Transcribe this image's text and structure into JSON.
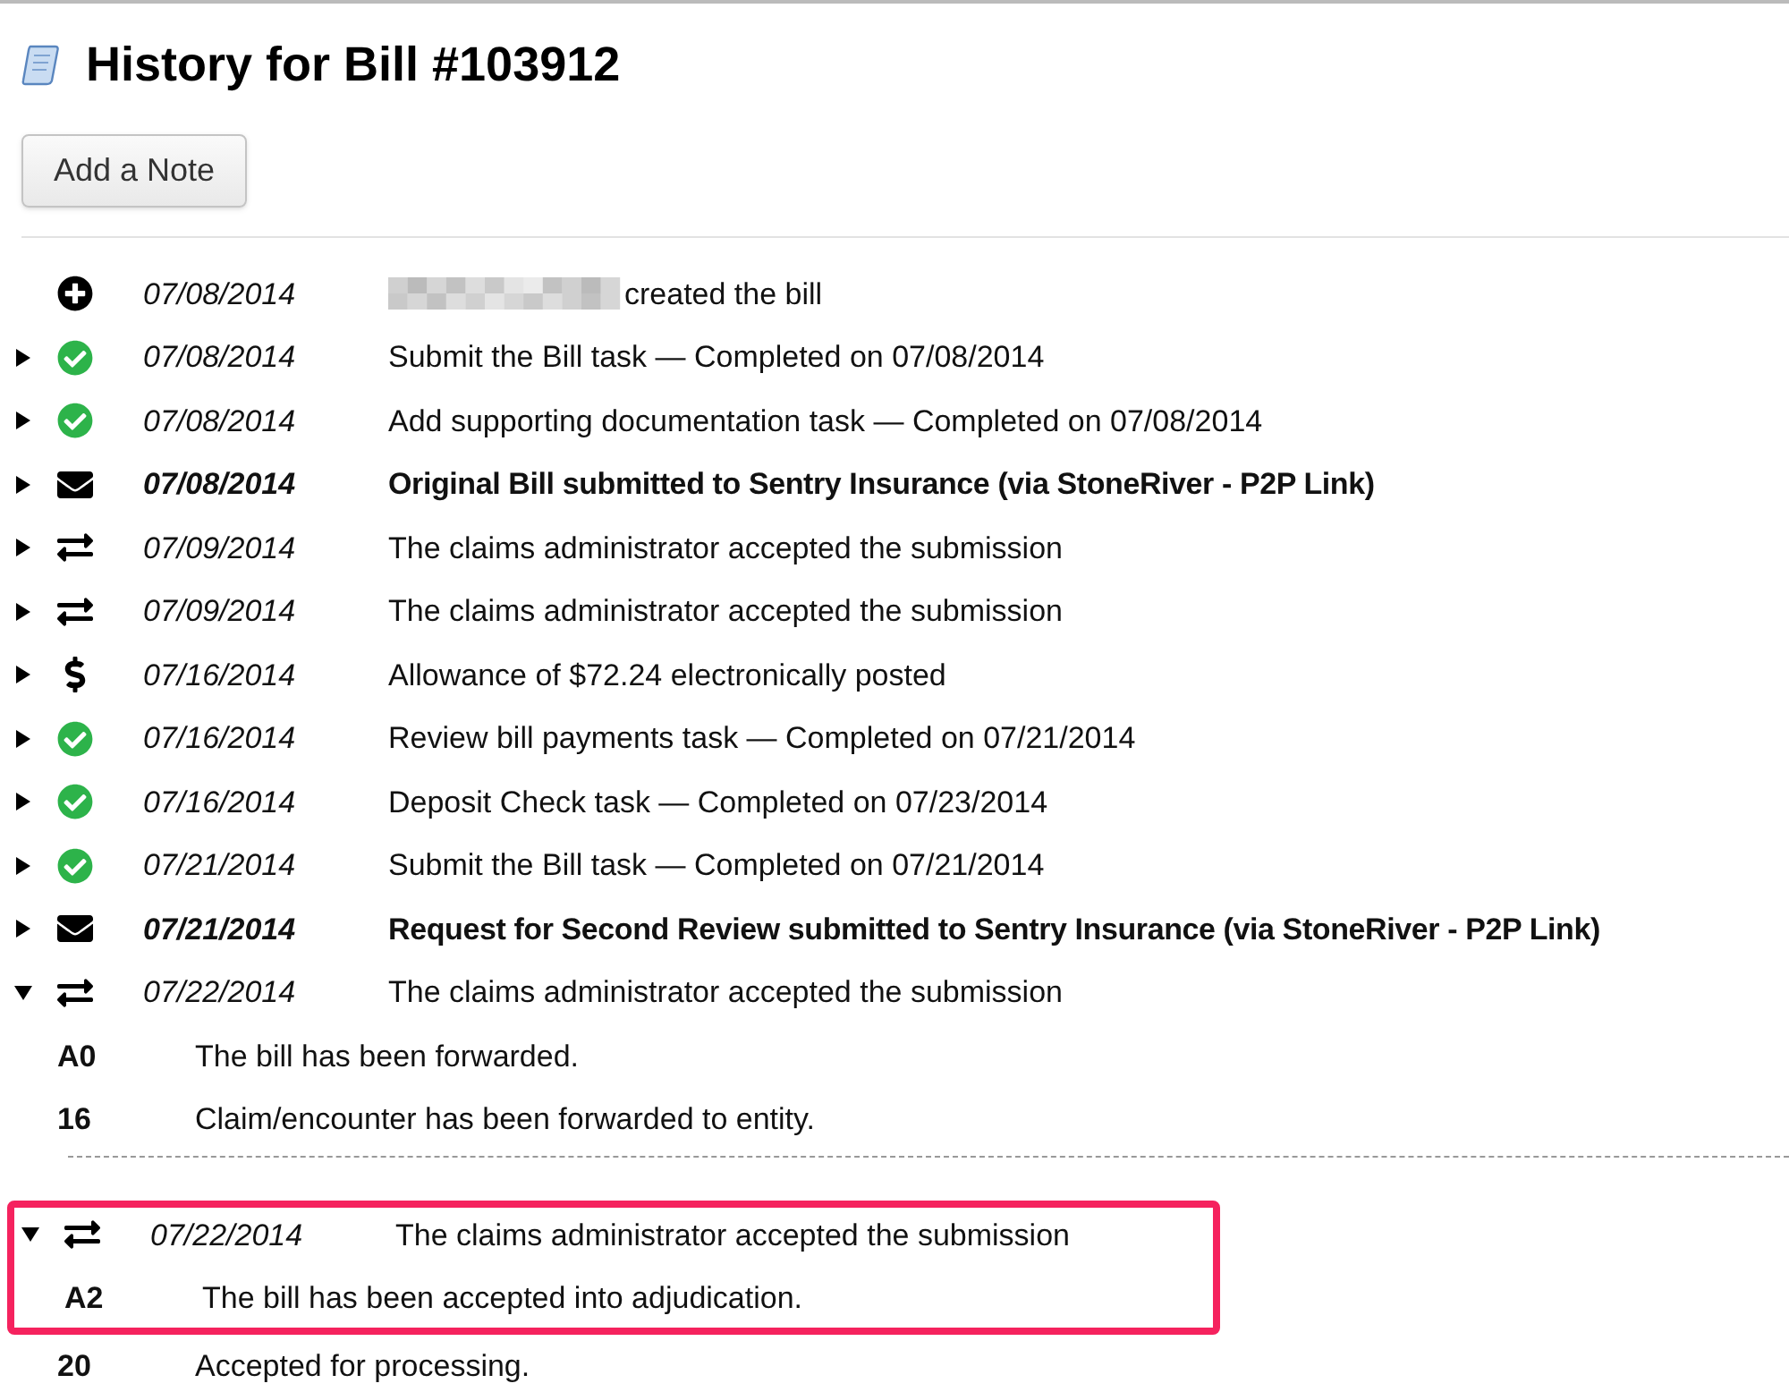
{
  "page": {
    "title": "History for Bill #103912"
  },
  "add_note_button": "Add a Note",
  "entries": [
    {
      "kind": "created",
      "date": "07/08/2014",
      "text": "created the bill",
      "bold": false,
      "redacted": true
    },
    {
      "kind": "task",
      "expanded": false,
      "date": "07/08/2014",
      "text": "Submit the Bill task — Completed on 07/08/2014",
      "bold": false
    },
    {
      "kind": "task",
      "expanded": false,
      "date": "07/08/2014",
      "text": "Add supporting documentation task — Completed on 07/08/2014",
      "bold": false
    },
    {
      "kind": "submission",
      "expanded": false,
      "date": "07/08/2014",
      "text": "Original Bill submitted to Sentry Insurance (via StoneRiver - P2P Link)",
      "bold": true
    },
    {
      "kind": "response",
      "expanded": false,
      "date": "07/09/2014",
      "text": "The claims administrator accepted the submission",
      "bold": false
    },
    {
      "kind": "response",
      "expanded": false,
      "date": "07/09/2014",
      "text": "The claims administrator accepted the submission",
      "bold": false
    },
    {
      "kind": "payment",
      "expanded": false,
      "date": "07/16/2014",
      "text": "Allowance of $72.24 electronically posted",
      "bold": false
    },
    {
      "kind": "task",
      "expanded": false,
      "date": "07/16/2014",
      "text": "Review bill payments task — Completed on 07/21/2014",
      "bold": false
    },
    {
      "kind": "task",
      "expanded": false,
      "date": "07/16/2014",
      "text": "Deposit Check task — Completed on 07/23/2014",
      "bold": false
    },
    {
      "kind": "task",
      "expanded": false,
      "date": "07/21/2014",
      "text": "Submit the Bill task — Completed on 07/21/2014",
      "bold": false
    },
    {
      "kind": "submission",
      "expanded": false,
      "date": "07/21/2014",
      "text": "Request for Second Review submitted to Sentry Insurance (via StoneRiver - P2P Link)",
      "bold": true
    },
    {
      "kind": "response",
      "expanded": true,
      "date": "07/22/2014",
      "text": "The claims administrator accepted the submission",
      "bold": false,
      "details": [
        {
          "code": "A0",
          "text": "The bill has been forwarded."
        },
        {
          "code": "16",
          "text": "Claim/encounter has been forwarded to entity."
        }
      ]
    },
    {
      "kind": "response",
      "expanded": true,
      "date": "07/22/2014",
      "text": "The claims administrator accepted the submission",
      "bold": false,
      "highlighted": true,
      "details": [
        {
          "code": "A2",
          "text": "The bill has been accepted into adjudication."
        },
        {
          "code": "20",
          "text": "Accepted for processing."
        }
      ]
    }
  ]
}
